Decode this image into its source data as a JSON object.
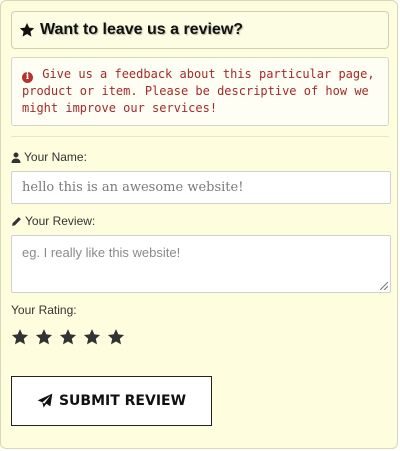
{
  "header": {
    "title": "Want to leave us a review?",
    "icon": "star-icon"
  },
  "notice": {
    "icon": "info-circle-icon",
    "text": "Give us a feedback about this particular page, product or item. Please be descriptive of how we might improve our services!",
    "line1": "Give us a feedback about this particular page,",
    "line2": "product or item. Please be descriptive of how we",
    "line3": "might improve our services!"
  },
  "form": {
    "name_label": "Your Name:",
    "name_icon": "user-icon",
    "name_value": "hello this is an awesome website!",
    "review_label": "Your Review:",
    "review_icon": "pencil-icon",
    "review_placeholder": "eg. I really like this website!",
    "rating_label": "Your Rating:",
    "rating_max": 5
  },
  "submit": {
    "label": "SUBMIT REVIEW",
    "icon": "paper-plane-icon"
  },
  "colors": {
    "panel_bg": "#fefedf",
    "notice_text": "#a42a2a",
    "star": "#333333"
  }
}
